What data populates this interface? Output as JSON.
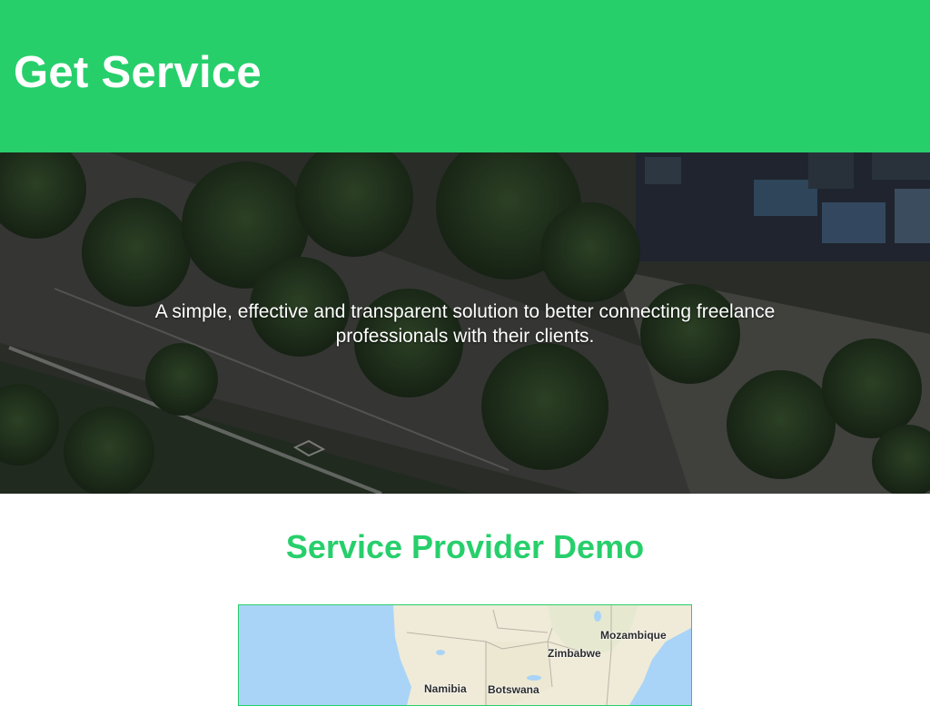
{
  "header": {
    "brand": "Get Service",
    "background": "#27cf6b"
  },
  "hero": {
    "tagline": "A simple, effective and transparent solution to better connecting freelance professionals with their clients."
  },
  "demo": {
    "title": "Service Provider Demo",
    "map": {
      "labels": {
        "mozambique": "Mozambique",
        "zimbabwe": "Zimbabwe",
        "namibia": "Namibia",
        "botswana": "Botswana"
      }
    }
  }
}
